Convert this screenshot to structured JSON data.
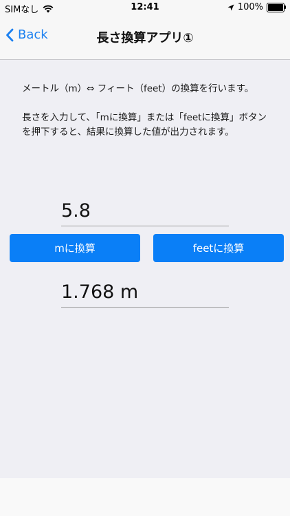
{
  "status": {
    "carrier": "SIMなし",
    "time": "12:41",
    "battery": "100%"
  },
  "nav": {
    "back_label": "Back",
    "title": "長さ換算アプリ①"
  },
  "description": {
    "line1": "メートル（m）⇔ フィート（feet）の換算を行います。",
    "line2": "長さを入力して、「mに換算」または「feetに換算」ボタンを押下すると、結果に換算した値が出力されます。"
  },
  "input": {
    "value": "5.8"
  },
  "buttons": {
    "to_m": "mに換算",
    "to_feet": "feetに換算"
  },
  "result": {
    "value": "1.768 m"
  },
  "colors": {
    "accent": "#0a7ff7",
    "background": "#efeff4"
  }
}
